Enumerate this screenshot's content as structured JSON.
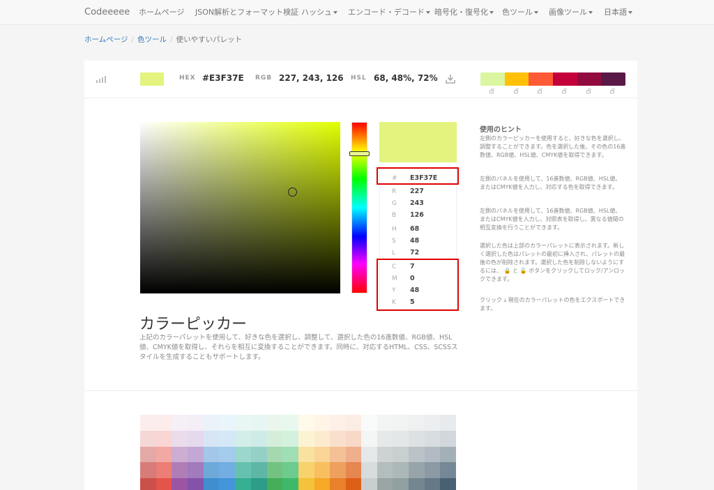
{
  "navbar": {
    "brand": "Codeeeee",
    "items": [
      {
        "label": "ホームページ",
        "dropdown": false
      },
      {
        "label": "JSON解析とフォーマット検証",
        "dropdown": false
      },
      {
        "label": "ハッシュ",
        "dropdown": true
      },
      {
        "label": "エンコード・デコード",
        "dropdown": true
      },
      {
        "label": "暗号化・復号化",
        "dropdown": true
      },
      {
        "label": "色ツール",
        "dropdown": true
      },
      {
        "label": "画像ツール",
        "dropdown": true
      },
      {
        "label": "日本語",
        "dropdown": true
      }
    ]
  },
  "breadcrumb": {
    "home": "ホームページ",
    "section": "色ツール",
    "current": "使いやすいパレット"
  },
  "current_color": {
    "hex_label": "HEX",
    "hex": "#E3F37E",
    "rgb_label": "RGB",
    "rgb": "227, 243, 126",
    "hsl_label": "HSL",
    "hsl": "68, 48%, 72%",
    "swatch_color": "#E3F37E"
  },
  "top_palette": [
    "#DCF5A0",
    "#FFC107",
    "#FF5A36",
    "#C4003B",
    "#920B3F",
    "#5A1846"
  ],
  "picker": {
    "hue_color": "#E1FF00",
    "hex_label": "#",
    "hex": "E3F37E",
    "rows": [
      {
        "label": "R",
        "value": "227"
      },
      {
        "label": "G",
        "value": "243"
      },
      {
        "label": "B",
        "value": "126"
      },
      {
        "label": "H",
        "value": "68"
      },
      {
        "label": "S",
        "value": "48"
      },
      {
        "label": "L",
        "value": "72"
      },
      {
        "label": "C",
        "value": "7"
      },
      {
        "label": "M",
        "value": "0"
      },
      {
        "label": "Y",
        "value": "48"
      },
      {
        "label": "K",
        "value": "5"
      }
    ]
  },
  "hints": {
    "title": "使用のヒント",
    "p1": "左側のカラーピッカーを使用すると、好きな色を選択し、調整することができます。色を選択した後、その色の16進数値、RGB値、HSL値、CMYK値を取得できます。",
    "p2": "左側のパネルを使用して、16進数値、RGB値、HSL値、またはCMYK値を入力し、対応する色を取得できます。",
    "p3": "左側のパネルを使用して、16進数値、RGB値、HSL値、またはCMYK値を入力し、対照表を取得し、異なる値間の相互変換を行うことができます。",
    "p4a": "選択した色は上部のカラーパレットに表示されます。新しく選択した色はパレットの最初に挿入され、パレットの最後の色が削除されます。選択した色を削除しないようにするには、",
    "p4b": "と",
    "p4c": "ボタンをクリックしてロック/アンロックできます。",
    "p5a": "クリック",
    "p5b": "現在のカラーパレットの色をエクスポートできます。"
  },
  "heading": "カラーピッカー",
  "description": "上記のカラーパレットを使用して、好きな色を選択し、調整して、選択した色の16進数値、RGB値、HSL値、CMYK値を取得し、それらを相互に変換することができます。同時に、対応するHTML、CSS、SCSSスタイルを生成することもサポートします。",
  "swatch_grid_left": [
    [
      "#FBEDED",
      "#FCEDEC",
      "#F6EFF6",
      "#F4EEF7",
      "#EBF2FA",
      "#EAF4FB",
      "#E8F6F4",
      "#E7F5F3",
      "#EAF6EC",
      "#E9F8EE",
      "#FEF9E9",
      "#FEF5E7",
      "#FDF0E6",
      "#FCEDE4"
    ],
    [
      "#F5D7D6",
      "#F9D5D3",
      "#EBDCEC",
      "#E5D9EE",
      "#D7E6F5",
      "#D5E8F7",
      "#D2EEE9",
      "#CFEBE7",
      "#D5EED9",
      "#D3F1DD",
      "#FCF3D3",
      "#FDEBCF",
      "#FAE0CC",
      "#F8D9C8"
    ],
    [
      "#E4A9A6",
      "#F2A8A3",
      "#CDADD1",
      "#C3A8D5",
      "#A3C7E8",
      "#A3CBEC",
      "#9BD8CB",
      "#95D0C6",
      "#A4D8AE",
      "#A0DEB5",
      "#F9E29F",
      "#FAD597",
      "#F4C095",
      "#EFAE8C"
    ],
    [
      "#D77C78",
      "#EC7E76",
      "#B17DB7",
      "#A17BBD",
      "#6FA9DA",
      "#72AEE2",
      "#66C2AE",
      "#5EB6A7",
      "#73C282",
      "#6DCB8D",
      "#F7D26D",
      "#F8BF5F",
      "#EEA05F",
      "#E68651"
    ],
    [
      "#CB4F4A",
      "#E5544A",
      "#9B55A4",
      "#8452A9",
      "#3F8ECF",
      "#4395D9",
      "#36AF93",
      "#2D9D8A",
      "#46AD59",
      "#3EB969",
      "#F4C23B",
      "#F6A826",
      "#E8812A",
      "#DE5F18"
    ]
  ],
  "swatch_grid_right": [
    [
      "#F9FAFA",
      "#F3F4F4",
      "#F2F3F3",
      "#EEF0F1",
      "#ECEEF0",
      "#E8EBED"
    ],
    [
      "#F4F5F5",
      "#E6E9E9",
      "#E3E7E7",
      "#DCE1E3",
      "#D8DDE1",
      "#D1D7DC"
    ],
    [
      "#E5E8E8",
      "#CDD3D3",
      "#C8CFCF",
      "#BAC3C7",
      "#B2BBC3",
      "#A3B0B8"
    ],
    [
      "#D7DCDC",
      "#B3BDBD",
      "#ACB7B7",
      "#97A5AB",
      "#8B9AA5",
      "#758895"
    ],
    [
      "#C9CFCF",
      "#9AA6A6",
      "#91A0A0",
      "#748790",
      "#657987",
      "#476072"
    ]
  ]
}
